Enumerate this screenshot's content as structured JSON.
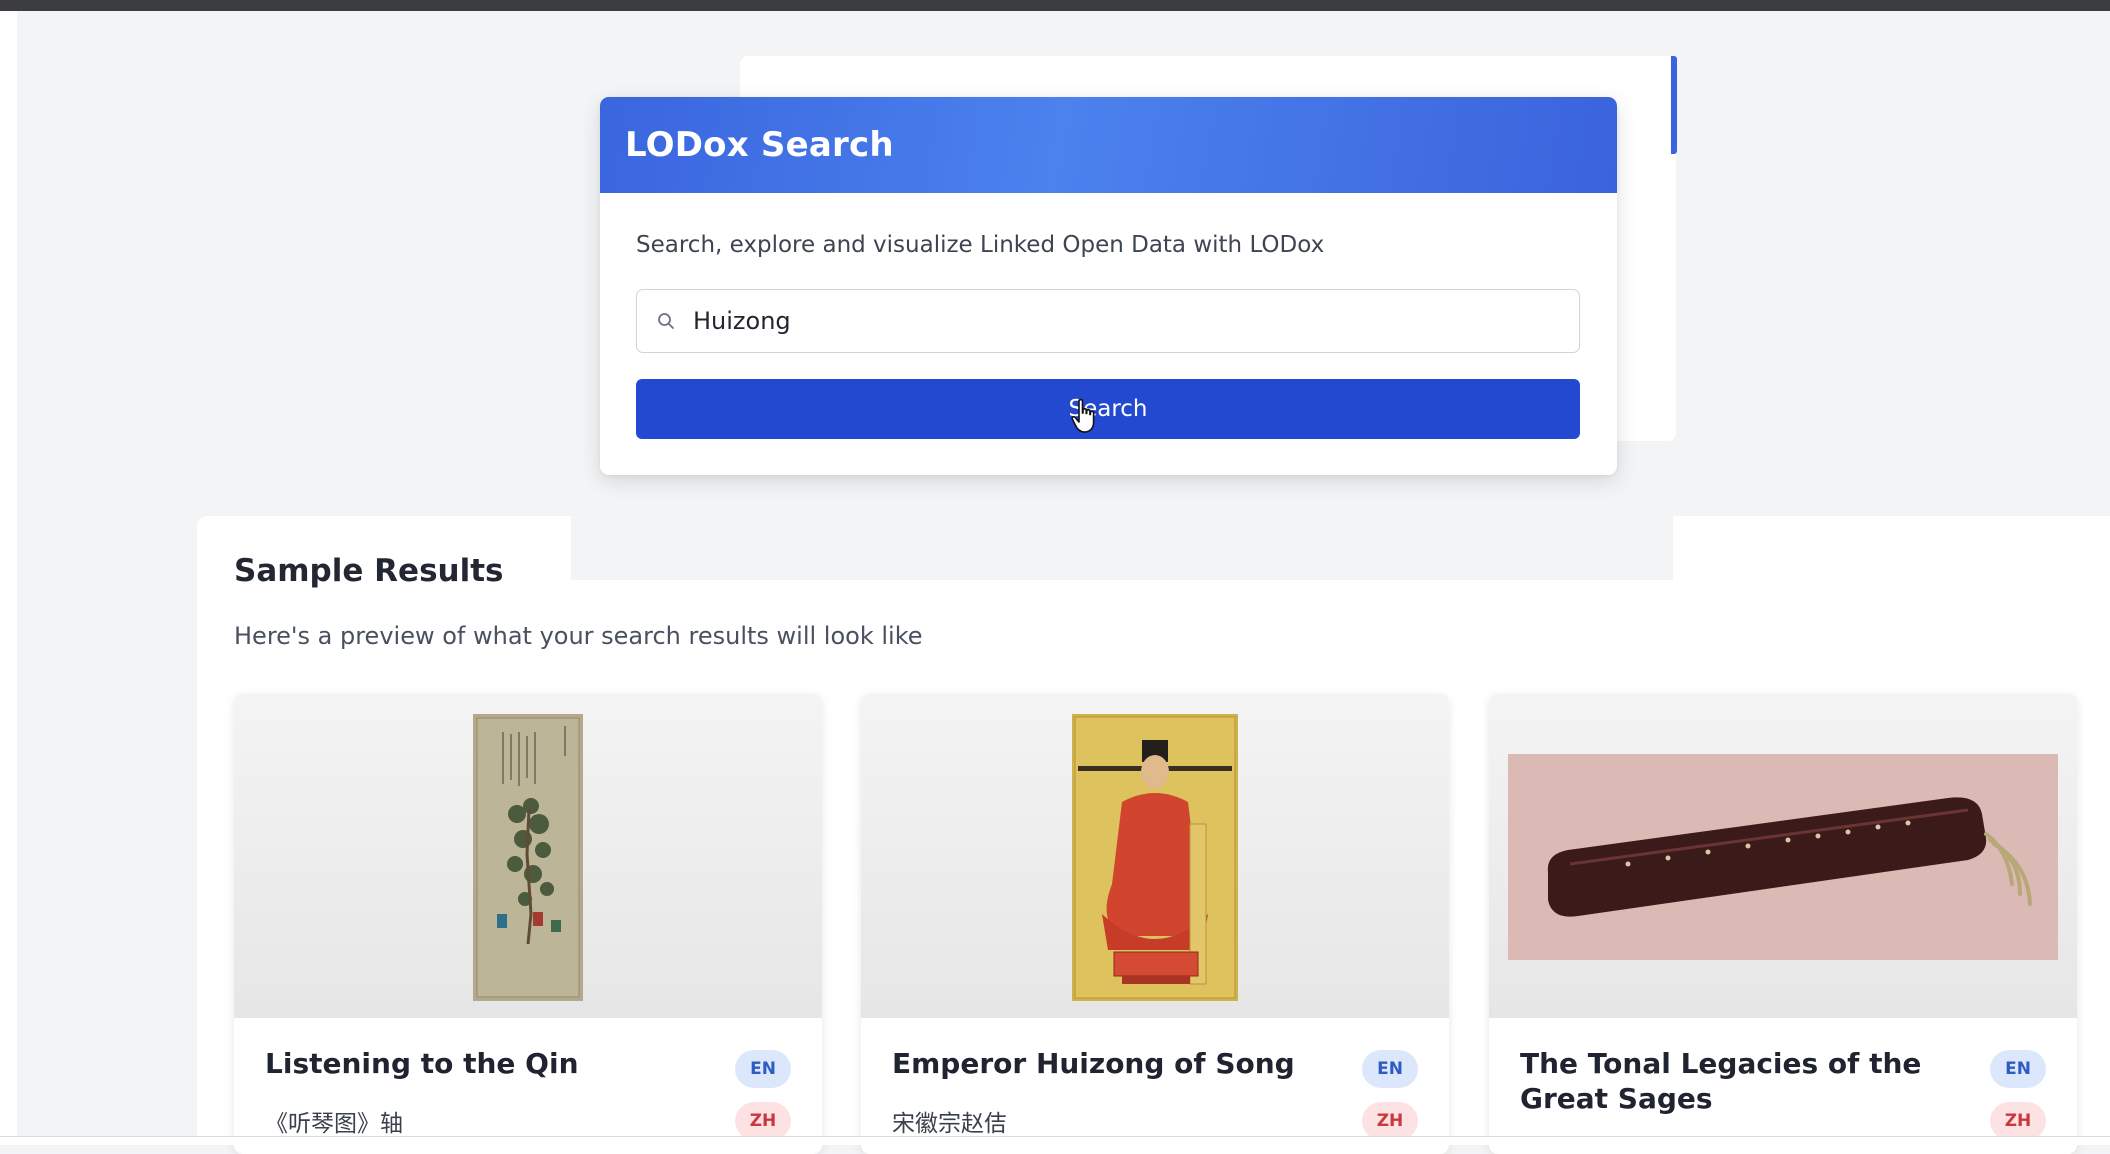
{
  "search_card": {
    "title": "LODox Search",
    "subtitle": "Search, explore and visualize Linked Open Data with LODox",
    "query_value": "Huizong",
    "button_label": "Search"
  },
  "results": {
    "title": "Sample Results",
    "subtitle": "Here's a preview of what your search results will look like",
    "cards": [
      {
        "title": "Listening to the Qin",
        "subtitle": "《听琴图》轴",
        "badges": [
          "EN",
          "ZH"
        ]
      },
      {
        "title": "Emperor Huizong of Song",
        "subtitle": "宋徽宗赵佶",
        "badges": [
          "EN",
          "ZH"
        ]
      },
      {
        "title": "The Tonal Legacies of the Great Sages",
        "subtitle": "",
        "badges": [
          "EN",
          "ZH"
        ]
      }
    ]
  },
  "colors": {
    "header_gradient": "#4b82ee",
    "button": "#2449d1",
    "badge_en_bg": "#dde7fb",
    "badge_zh_bg": "#fde2e3"
  },
  "icons": {
    "search_field": "search-icon",
    "pointer": "hand-cursor-icon"
  }
}
